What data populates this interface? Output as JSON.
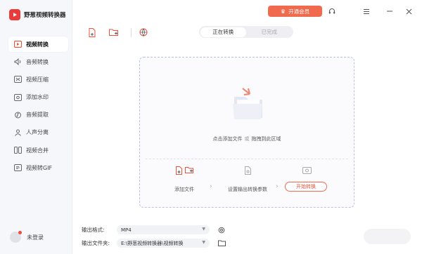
{
  "app": {
    "name": "野葱视频转换器"
  },
  "topbar": {
    "vip_label": "开通会员"
  },
  "sidebar": {
    "items": [
      {
        "label": "视频转换",
        "icon": "video-convert-icon"
      },
      {
        "label": "音频转换",
        "icon": "audio-convert-icon"
      },
      {
        "label": "视频压缩",
        "icon": "video-compress-icon"
      },
      {
        "label": "添加水印",
        "icon": "watermark-icon"
      },
      {
        "label": "音频提取",
        "icon": "audio-extract-icon"
      },
      {
        "label": "人声分离",
        "icon": "voice-separate-icon"
      },
      {
        "label": "视频合并",
        "icon": "video-merge-icon"
      },
      {
        "label": "视频转GIF",
        "icon": "video-gif-icon"
      }
    ],
    "user_label": "未登录"
  },
  "tabs": {
    "converting": "正在转换",
    "done": "已完成"
  },
  "dropzone": {
    "click_add": "点击添加文件",
    "or": "或",
    "drag_here": "拖拽到此区域",
    "steps": {
      "add_files": "添加文件",
      "set_params": "设置输出转换参数",
      "start": "开始转换"
    }
  },
  "output": {
    "format_label": "输出格式:",
    "format_value": "MP4",
    "folder_label": "输出文件夹:",
    "folder_value": "E:\\野葱视频转换器\\视频转换"
  },
  "colors": {
    "accent": "#F06B4E",
    "logo": "#EA3A3A",
    "sidebar_bg": "#F6F7FB",
    "dropzone_border": "#B9C1E8"
  }
}
